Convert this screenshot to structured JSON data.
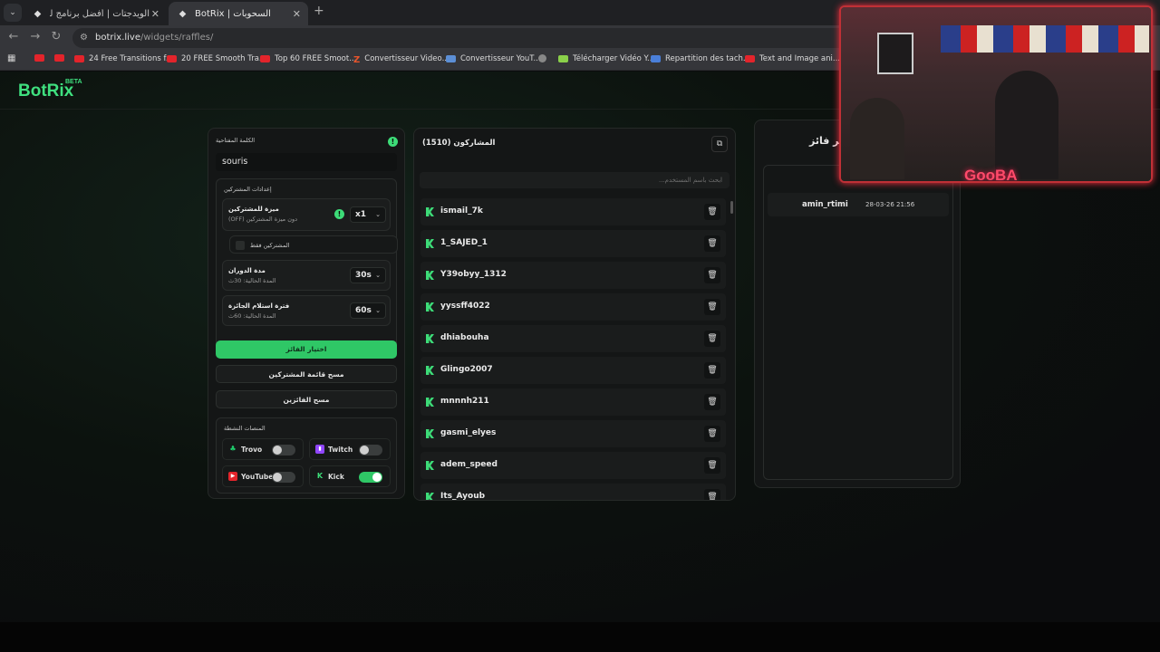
{
  "browser": {
    "tabs": [
      {
        "title": "الويدجتات | أفضل برنامج لتعزيز ال...",
        "active": false
      },
      {
        "title": "BotRix | السحوبات",
        "active": true
      }
    ],
    "url_host": "botrix.live",
    "url_path": "/widgets/raffles/",
    "bookmarks": [
      "",
      "",
      "24 Free Transitions f...",
      "20 FREE Smooth Tra...",
      "Top 60 FREE Smoot...",
      "Convertisseur Video...",
      "Convertisseur YouT...",
      "",
      "Télécharger Vidéo Y...",
      "Repartition des tach...",
      "Text and Image ani..."
    ]
  },
  "app": {
    "logo": "BotRix",
    "logo_badge": "BETA"
  },
  "settings": {
    "keyword_label": "الكلمة المفتاحية",
    "keyword_value": "souris",
    "participants_settings_label": "إعدادات المشتركين",
    "subscriber_perk_title": "ميزة للمشتركين",
    "subscriber_perk_sub": "دون ميزة المشتركين (OFF)",
    "subscriber_multiplier": "x1",
    "subscribers_only_label": "المشتركين فقط",
    "duration_title": "مدة الدوران",
    "duration_sub": "المدة الحالية: 30ث",
    "duration_value": "30s",
    "claim_title": "فترة استلام الجائزة",
    "claim_sub": "المدة الحالية: 60ث",
    "claim_value": "60s",
    "pick_winner": "اختيار الفائز",
    "clear_participants": "مسح قائمة المشتركين",
    "clear_winners": "مسح الفائزين",
    "platforms_label": "المنصات النشطة",
    "platforms": [
      {
        "name": "Trovo",
        "on": false
      },
      {
        "name": "Twitch",
        "on": false
      },
      {
        "name": "YouTube",
        "on": false
      },
      {
        "name": "Kick",
        "on": true
      }
    ]
  },
  "participants": {
    "title": "المشاركون (1510)",
    "search_placeholder": "ابحث باسم المستخدم...",
    "list": [
      "ismail_7k",
      "1_SAJED_1",
      "Y39obyy_1312",
      "yyssff4022",
      "dhiabouha",
      "Glingo2007",
      "mnnnh211",
      "gasmi_elyes",
      "adem_speed",
      "Its_Ayoub"
    ]
  },
  "winners": {
    "title": "آخر فائز",
    "list": [
      {
        "name": "amin_rtimi",
        "time": "28-03-26 21:56"
      }
    ]
  },
  "overlay": {
    "caption": "GooBA"
  },
  "colors": {
    "accent": "#3ddc78",
    "button_green": "#2fc766"
  }
}
